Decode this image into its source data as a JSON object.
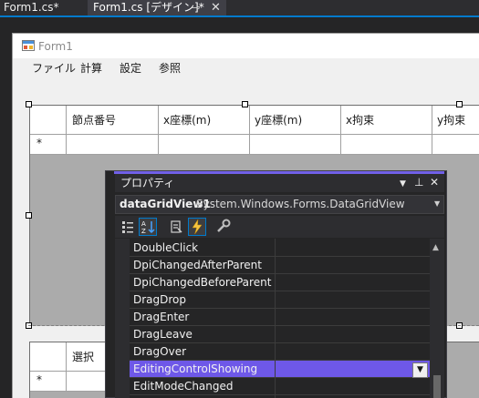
{
  "tabs": [
    {
      "label": "Form1.cs*"
    },
    {
      "label": "Form1.cs [デザイン]*"
    }
  ],
  "form": {
    "title": "Form1",
    "menu": [
      "ファイル",
      "計算",
      "設定",
      "参照"
    ]
  },
  "grid1": {
    "columns": [
      "節点番号",
      "x座標(m)",
      "y座標(m)",
      "x拘束",
      "y拘束"
    ],
    "new_row_marker": "*"
  },
  "grid2": {
    "columns": [
      "選択"
    ],
    "new_row_marker": "*"
  },
  "properties": {
    "title": "プロパティ",
    "object_name": "dataGridView1",
    "object_type": "System.Windows.Forms.DataGridView",
    "events": [
      "DoubleClick",
      "DpiChangedAfterParent",
      "DpiChangedBeforeParent",
      "DragDrop",
      "DragEnter",
      "DragLeave",
      "DragOver",
      "EditingControlShowing",
      "EditModeChanged"
    ],
    "selected_event": "EditingControlShowing"
  },
  "colors": {
    "accent": "#007acc",
    "selection": "#6e58e8"
  }
}
